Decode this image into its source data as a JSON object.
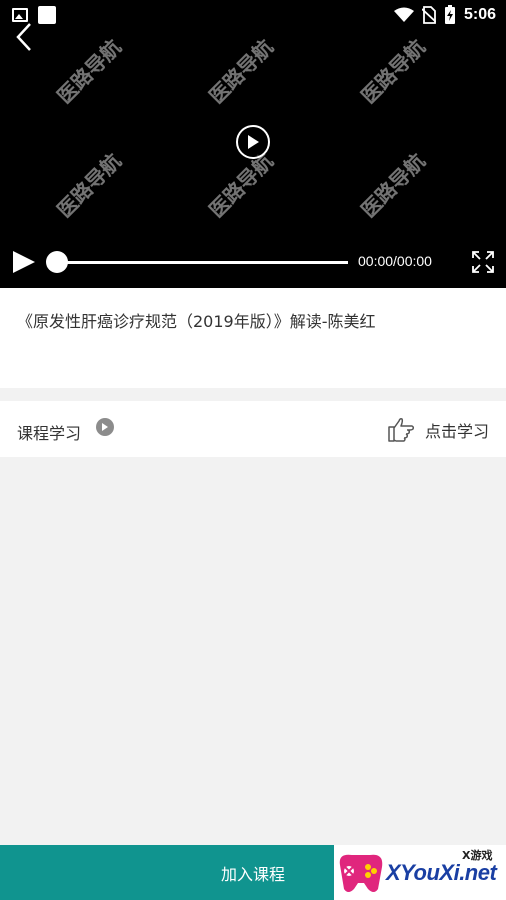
{
  "status_bar": {
    "time": "5:06",
    "left_icons": [
      "image-icon",
      "square-icon"
    ],
    "right_icons": [
      "wifi-icon",
      "no-sim-icon",
      "battery-charging-icon"
    ]
  },
  "video": {
    "watermark_text": "医路导航",
    "current_time": "00:00/00:00",
    "progress": 0,
    "icons": [
      "back-arrow-icon",
      "play-icon",
      "fullscreen-icon"
    ]
  },
  "lesson": {
    "title": "《原发性肝癌诊疗规范（2019年版）》解读-陈美红"
  },
  "course": {
    "label": "课程学习",
    "action_label": "点击学习",
    "icons": [
      "play-circle-icon",
      "pointing-hand-icon"
    ]
  },
  "bottom": {
    "join_label": "加入课程",
    "logo_text": "XYouXi.net",
    "logo_badge": "X游戏"
  },
  "colors": {
    "accent": "#10948f",
    "video_bg": "#000000",
    "page_bg": "#f2f2f2"
  }
}
